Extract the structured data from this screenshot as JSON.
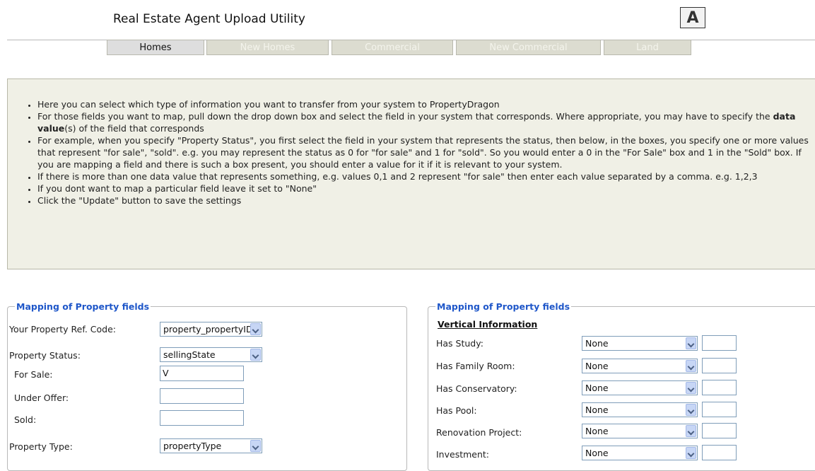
{
  "header": {
    "title": "Real Estate Agent Upload Utility",
    "logo_letter": "A"
  },
  "tabs": [
    {
      "label": "Homes",
      "active": true
    },
    {
      "label": "New Homes",
      "active": false
    },
    {
      "label": "Commercial",
      "active": false
    },
    {
      "label": "New Commercial",
      "active": false
    },
    {
      "label": "Land",
      "active": false
    }
  ],
  "instructions": [
    {
      "text": "Here you can select which type of information you want to transfer from your system to PropertyDragon"
    },
    {
      "pre": "For those fields you want to map, pull down the drop down box and select the field in your system that corresponds. Where appropriate, you may have to specify the ",
      "bold": "data value",
      "post": "(s) of the field that corresponds"
    },
    {
      "text": "For example, when you specify \"Property Status\", you first select the field in your system that represents the status, then below, in the boxes, you specify one or more values that represent \"for sale\", \"sold\". e.g. you may represent the status as 0 for \"for sale\" and 1 for \"sold\". So you would enter a 0 in the \"For Sale\" box and 1 in the \"Sold\" box. If you are mapping a field and there is such a box present, you should enter a value for it if it is relevant to your system."
    },
    {
      "text": "If there is more than one data value that represents something, e.g. values 0,1 and 2 represent \"for sale\" then enter each value separated by a comma. e.g. 1,2,3"
    },
    {
      "text": "If you dont want to map a particular field leave it set to \"None\""
    },
    {
      "text": "Click the \"Update\" button to save the settings"
    }
  ],
  "left_panel": {
    "legend": "Mapping of Property fields",
    "ref_code": {
      "label": "Your Property Ref. Code:",
      "value": "property_propertyID"
    },
    "status": {
      "label": "Property Status:",
      "value": "sellingState"
    },
    "for_sale": {
      "label": "For Sale:",
      "value": "V"
    },
    "under_offer": {
      "label": "Under Offer:",
      "value": ""
    },
    "sold": {
      "label": "Sold:",
      "value": ""
    },
    "type": {
      "label": "Property Type:",
      "value": "propertyType"
    }
  },
  "right_panel": {
    "legend": "Mapping of Property fields",
    "subheading": "Vertical Information",
    "rows": [
      {
        "label": "Has Study:",
        "value": "None",
        "extra": ""
      },
      {
        "label": "Has Family Room:",
        "value": "None",
        "extra": ""
      },
      {
        "label": "Has Conservatory:",
        "value": "None",
        "extra": ""
      },
      {
        "label": "Has Pool:",
        "value": "None",
        "extra": ""
      },
      {
        "label": "Renovation Project:",
        "value": "None",
        "extra": ""
      },
      {
        "label": "Investment:",
        "value": "None",
        "extra": ""
      }
    ]
  }
}
